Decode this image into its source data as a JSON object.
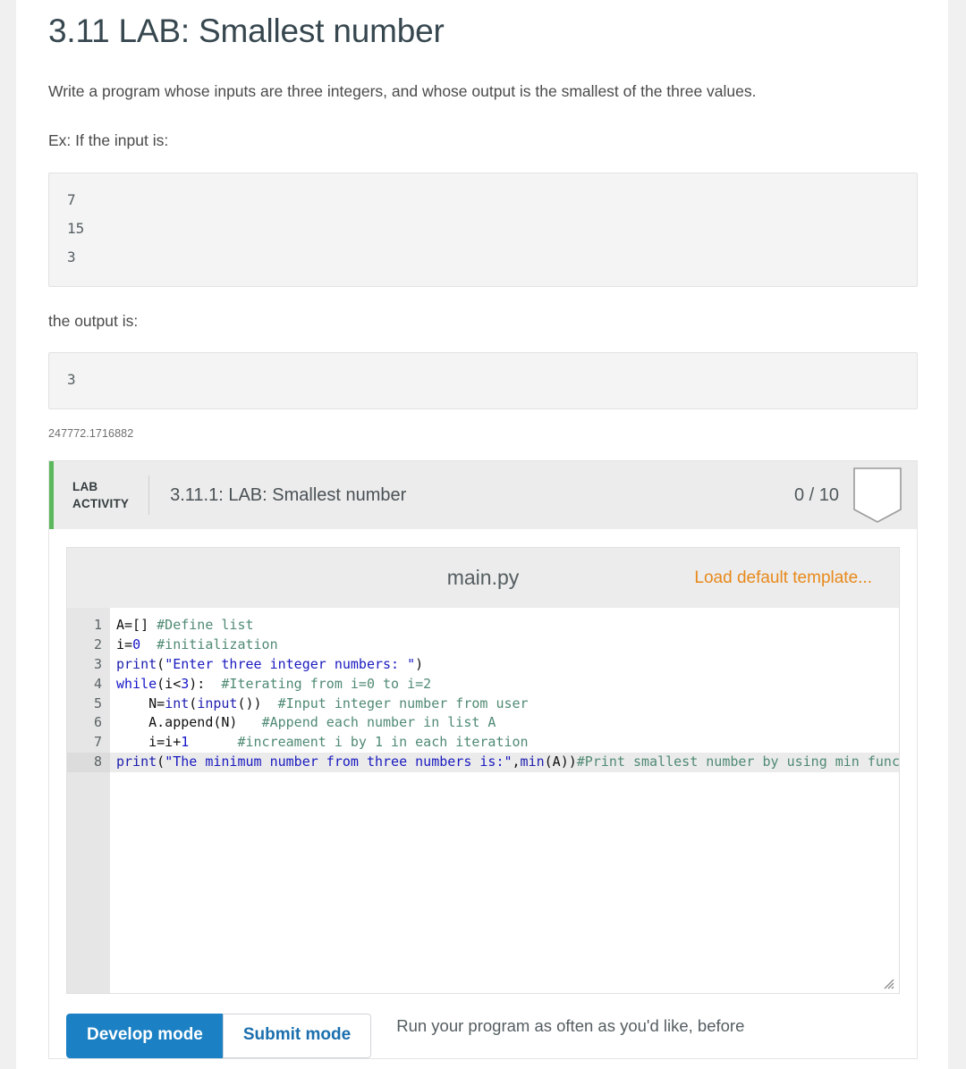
{
  "page": {
    "title": "3.11 LAB: Smallest number",
    "description": "Write a program whose inputs are three integers, and whose output is the smallest of the three values.",
    "input_prompt": "Ex: If the input is:",
    "output_prompt": "the output is:",
    "sample_input_lines": [
      "7",
      "15",
      "3"
    ],
    "sample_output_lines": [
      "3"
    ],
    "reference_id": "247772.1716882"
  },
  "lab_activity": {
    "tag_line1": "LAB",
    "tag_line2": "ACTIVITY",
    "title": "3.11.1: LAB: Smallest number",
    "score": "0 / 10",
    "badge_icon": "bookmark-ribbon-icon",
    "accent_color": "#5cb85c"
  },
  "editor": {
    "filename": "main.py",
    "load_default_label": "Load default template...",
    "active_line": 8,
    "resize_handle_icon": "resize-grip-icon",
    "line_numbers": [
      "1",
      "2",
      "3",
      "4",
      "5",
      "6",
      "7",
      "8"
    ],
    "lines": [
      {
        "n": "1",
        "tokens": [
          {
            "t": "A=[] ",
            "c": "plain"
          },
          {
            "t": "#Define list",
            "c": "cmt"
          }
        ]
      },
      {
        "n": "2",
        "tokens": [
          {
            "t": "i=",
            "c": "plain"
          },
          {
            "t": "0",
            "c": "num"
          },
          {
            "t": "  ",
            "c": "plain"
          },
          {
            "t": "#initialization",
            "c": "cmt"
          }
        ]
      },
      {
        "n": "3",
        "tokens": [
          {
            "t": "print",
            "c": "fn"
          },
          {
            "t": "(",
            "c": "plain"
          },
          {
            "t": "\"Enter three integer numbers: \"",
            "c": "str"
          },
          {
            "t": ")",
            "c": "plain"
          }
        ]
      },
      {
        "n": "4",
        "tokens": [
          {
            "t": "while",
            "c": "kw"
          },
          {
            "t": "(i<",
            "c": "plain"
          },
          {
            "t": "3",
            "c": "num"
          },
          {
            "t": "):  ",
            "c": "plain"
          },
          {
            "t": "#Iterating from i=0 to i=2",
            "c": "cmt"
          }
        ]
      },
      {
        "n": "5",
        "tokens": [
          {
            "t": "    N=",
            "c": "plain"
          },
          {
            "t": "int",
            "c": "fn"
          },
          {
            "t": "(",
            "c": "plain"
          },
          {
            "t": "input",
            "c": "fn"
          },
          {
            "t": "())  ",
            "c": "plain"
          },
          {
            "t": "#Input integer number from user",
            "c": "cmt"
          }
        ]
      },
      {
        "n": "6",
        "tokens": [
          {
            "t": "    A.append(N)   ",
            "c": "plain"
          },
          {
            "t": "#Append each number in list A",
            "c": "cmt"
          }
        ]
      },
      {
        "n": "7",
        "tokens": [
          {
            "t": "    i=i+",
            "c": "plain"
          },
          {
            "t": "1",
            "c": "num"
          },
          {
            "t": "      ",
            "c": "plain"
          },
          {
            "t": "#increament i by 1 in each iteration",
            "c": "cmt"
          }
        ]
      },
      {
        "n": "8",
        "tokens": [
          {
            "t": "print",
            "c": "fn"
          },
          {
            "t": "(",
            "c": "plain"
          },
          {
            "t": "\"The minimum number from three numbers is:\"",
            "c": "str"
          },
          {
            "t": ",",
            "c": "plain"
          },
          {
            "t": "min",
            "c": "fn"
          },
          {
            "t": "(A))",
            "c": "plain"
          },
          {
            "t": "#Print smallest number by using min function",
            "c": "cmt"
          }
        ]
      }
    ]
  },
  "modes": {
    "develop_label": "Develop mode",
    "submit_label": "Submit mode",
    "active": "Develop mode",
    "run_note": "Run your program as often as you'd like, before",
    "accent_color": "#1b80c4"
  }
}
